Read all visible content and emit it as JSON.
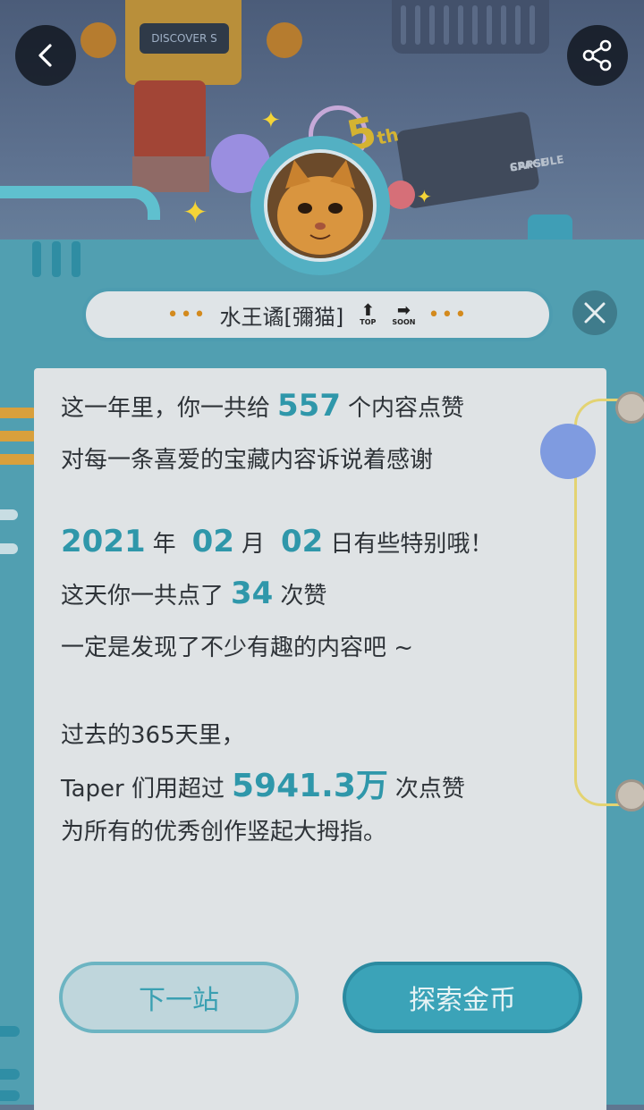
{
  "header": {
    "machine_screen_text": "DISCOVER S",
    "capsule_text_line1": "SPACE",
    "capsule_text_line2": "CAPSULE",
    "anniversary_number": "5",
    "anniversary_suffix": "th"
  },
  "profile": {
    "username": "水王谲[彌猫]",
    "badge_top_label": "TOP",
    "badge_soon_label": "SOON",
    "dots_left": "•••",
    "dots_right": "•••"
  },
  "stats": {
    "likes_prefix": "这一年里，你一共给",
    "likes_count": "557",
    "likes_suffix": "个内容点赞",
    "likes_line2": "对每一条喜爱的宝藏内容诉说着感谢",
    "year": "2021",
    "year_unit": "年",
    "month": "02",
    "month_unit": "月",
    "day": "02",
    "day_suffix": "日有些特别哦！",
    "day_likes_prefix": "这天你一共点了",
    "day_likes_count": "34",
    "day_likes_suffix": "次赞",
    "day_line3": "一定是发现了不少有趣的内容吧 ~",
    "past_line": "过去的365天里，",
    "community_prefix": "Taper 们用超过",
    "community_count": "5941.3万",
    "community_suffix": "次点赞",
    "community_line3": "为所有的优秀创作竖起大拇指。"
  },
  "buttons": {
    "next_label": "下一站",
    "explore_label": "探索金币"
  },
  "icons": {
    "back": "chevron-left-icon",
    "share": "share-icon",
    "close": "close-icon"
  },
  "colors": {
    "accent_number": "#2f97aa",
    "panel": "#519fb1",
    "card": "#dfe3e5",
    "dots": "#d38a1e"
  }
}
